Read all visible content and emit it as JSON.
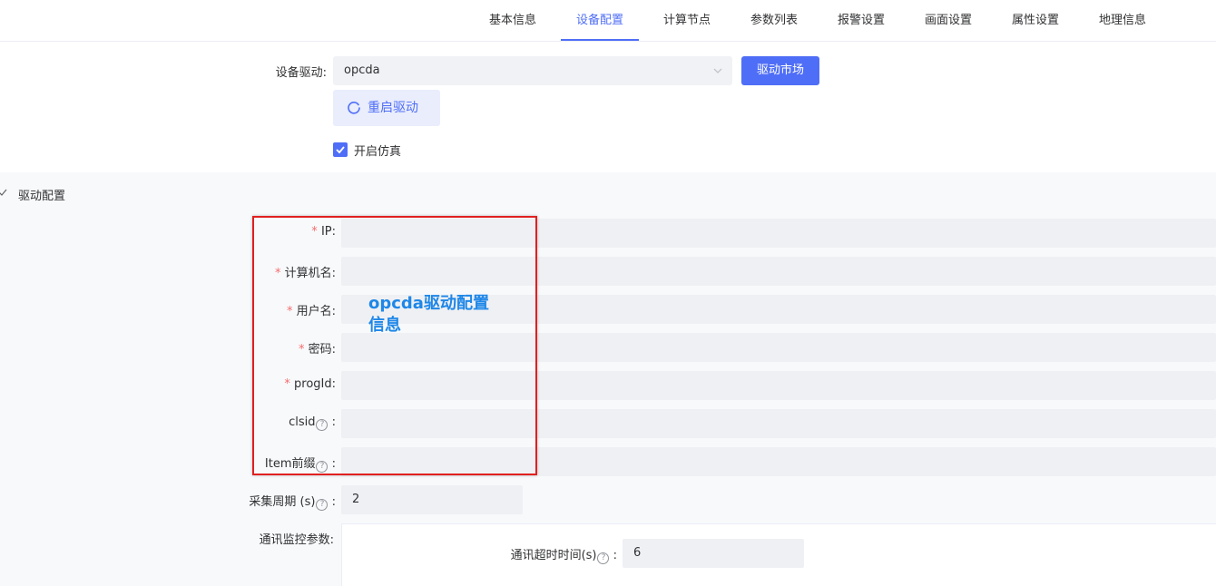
{
  "tabs": [
    {
      "label": "基本信息",
      "active": false
    },
    {
      "label": "设备配置",
      "active": true
    },
    {
      "label": "计算节点",
      "active": false
    },
    {
      "label": "参数列表",
      "active": false
    },
    {
      "label": "报警设置",
      "active": false
    },
    {
      "label": "画面设置",
      "active": false
    },
    {
      "label": "属性设置",
      "active": false
    },
    {
      "label": "地理信息",
      "active": false
    }
  ],
  "driver": {
    "label": "设备驱动:",
    "value": "opcda",
    "market_button": "驱动市场",
    "restart_button": "重启驱动",
    "simulate_label": "开启仿真",
    "simulate_checked": true
  },
  "config": {
    "section_title": "驱动配置",
    "fields": [
      {
        "label": "IP:",
        "required": true,
        "help": false,
        "value": ""
      },
      {
        "label": "计算机名:",
        "required": true,
        "help": false,
        "value": ""
      },
      {
        "label": "用户名:",
        "required": true,
        "help": false,
        "value": ""
      },
      {
        "label": "密码:",
        "required": true,
        "help": false,
        "value": ""
      },
      {
        "label": "progId:",
        "required": true,
        "help": false,
        "value": ""
      },
      {
        "label": "clsid",
        "required": false,
        "help": true,
        "value": ""
      },
      {
        "label": "Item前缀",
        "required": false,
        "help": true,
        "value": ""
      }
    ],
    "annotation": "opcda驱动配置信息",
    "collect_period_label": "采集周期 (s)",
    "collect_period_value": "2",
    "comm_monitor_label": "通讯监控参数:",
    "comm_timeout_label": "通讯超时时间(s)",
    "comm_timeout_value": "6"
  },
  "colors": {
    "accent": "#4f6ef7",
    "required_star": "#f56c6c",
    "annotation_box": "#e02020",
    "annotation_text": "#1e87e8"
  }
}
